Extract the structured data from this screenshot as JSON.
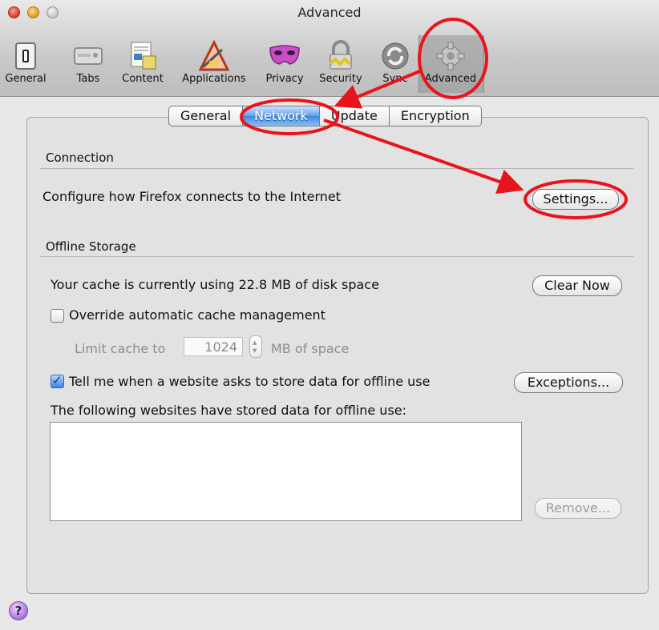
{
  "window": {
    "title": "Advanced"
  },
  "toolbar": {
    "items": [
      {
        "label": "General",
        "icon": "switch-icon"
      },
      {
        "label": "Tabs",
        "icon": "tabs-icon"
      },
      {
        "label": "Content",
        "icon": "content-icon"
      },
      {
        "label": "Applications",
        "icon": "applications-icon"
      },
      {
        "label": "Privacy",
        "icon": "mask-icon"
      },
      {
        "label": "Security",
        "icon": "padlock-icon"
      },
      {
        "label": "Sync",
        "icon": "sync-icon"
      },
      {
        "label": "Advanced",
        "icon": "gear-icon"
      }
    ],
    "selected": "Advanced"
  },
  "tabs": {
    "items": [
      "General",
      "Network",
      "Update",
      "Encryption"
    ],
    "selected": "Network"
  },
  "connection": {
    "heading": "Connection",
    "description": "Configure how Firefox connects to the Internet",
    "settings_button": "Settings..."
  },
  "offline": {
    "heading": "Offline Storage",
    "cache_text": "Your cache is currently using 22.8 MB of disk space",
    "clear_button": "Clear Now",
    "override_label": "Override automatic cache management",
    "override_checked": false,
    "limit_label": "Limit cache to",
    "limit_value": "1024",
    "limit_unit": "MB of space",
    "tell_label": "Tell me when a website asks to store data for offline use",
    "tell_checked": true,
    "exceptions_button": "Exceptions...",
    "list_label": "The following websites have stored data for offline use:",
    "remove_button": "Remove..."
  },
  "help": {
    "icon": "help-icon",
    "symbol": "?"
  },
  "colors": {
    "annotation": "#e8141c",
    "selected_tab": "#3f86e0"
  }
}
